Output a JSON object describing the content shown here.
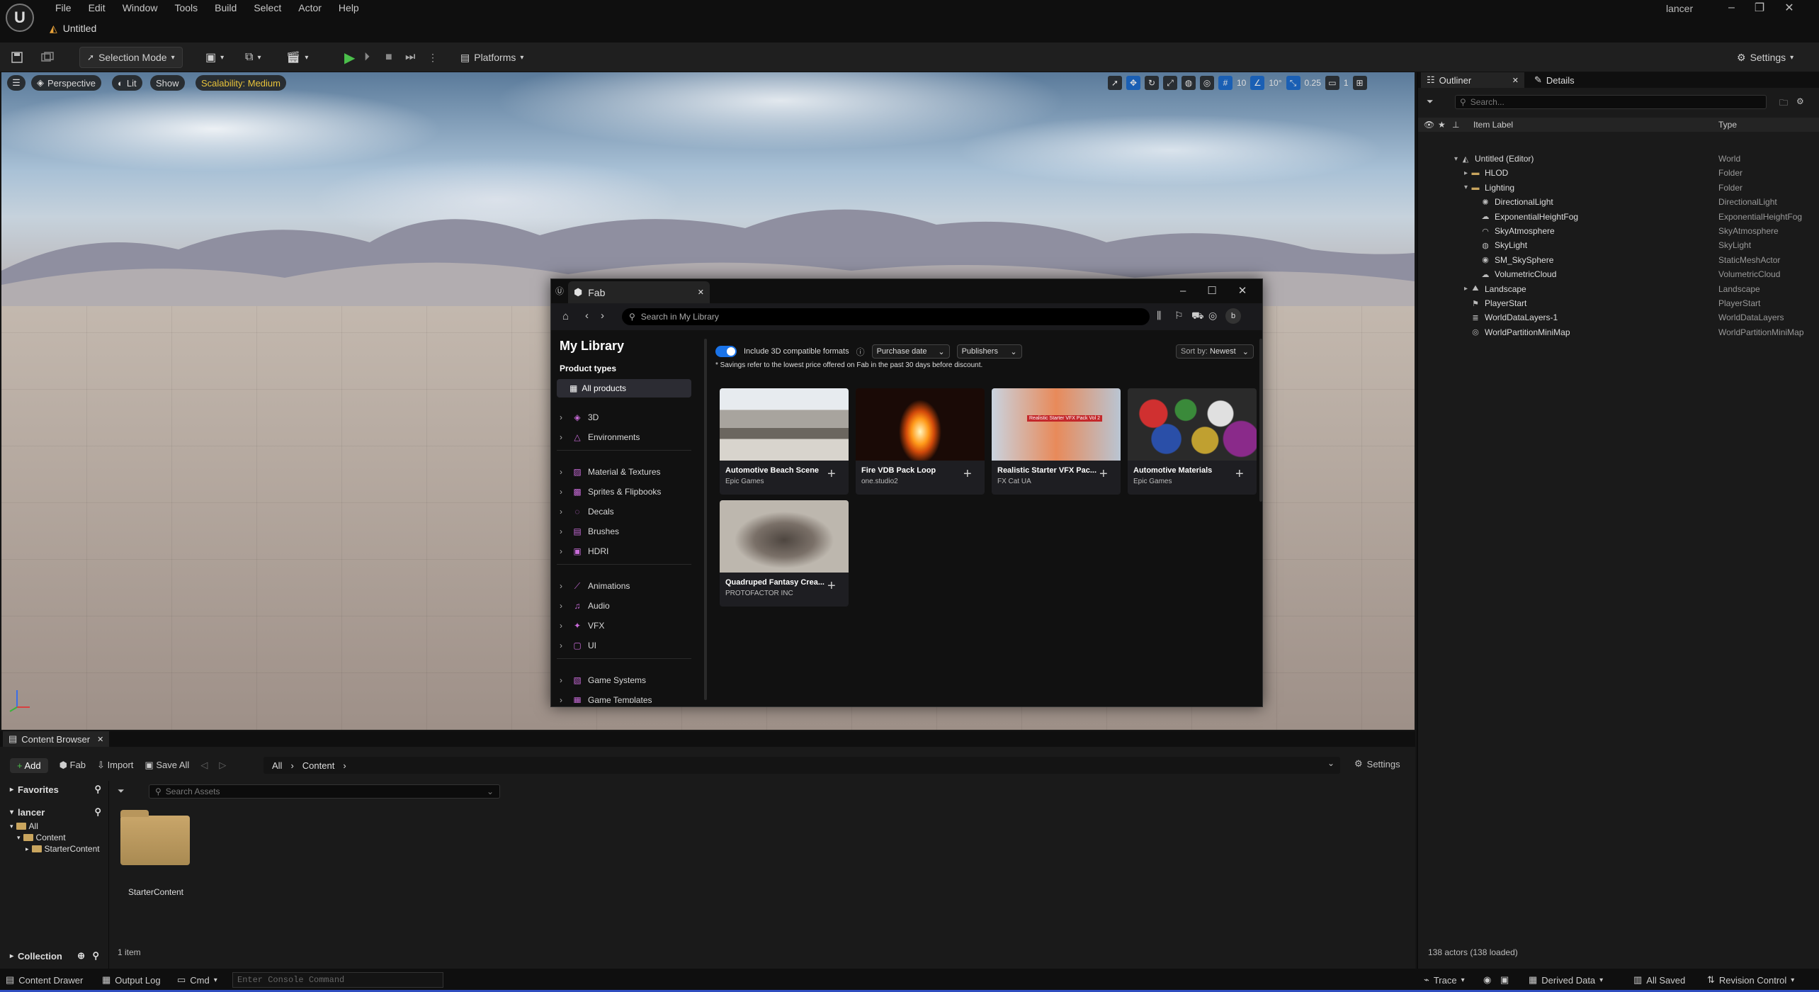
{
  "app": {
    "logo": "U",
    "menus": [
      "File",
      "Edit",
      "Window",
      "Tools",
      "Build",
      "Select",
      "Actor",
      "Help"
    ],
    "doc_tab": "Untitled",
    "user": "lancer"
  },
  "toolbar": {
    "selection_mode": "Selection Mode",
    "platforms": "Platforms",
    "settings": "Settings"
  },
  "viewport": {
    "perspective": "Perspective",
    "lit": "Lit",
    "show": "Show",
    "scalability": "Scalability: Medium",
    "grid_snap": "10",
    "rot_snap": "10°",
    "scale_snap": "0.25",
    "cam_speed": "1"
  },
  "fab": {
    "title": "Fab",
    "search_placeholder": "Search in My Library",
    "heading": "My Library",
    "product_types": "Product types",
    "all_products": "All products",
    "categories": [
      {
        "label": "3D",
        "icon": "cube-icon"
      },
      {
        "label": "Environments",
        "icon": "mountain-icon"
      },
      {
        "label": "Material & Textures",
        "icon": "material-icon"
      },
      {
        "label": "Sprites & Flipbooks",
        "icon": "sprite-icon"
      },
      {
        "label": "Decals",
        "icon": "decal-icon"
      },
      {
        "label": "Brushes",
        "icon": "brush-icon"
      },
      {
        "label": "HDRI",
        "icon": "hdri-icon"
      },
      {
        "label": "Animations",
        "icon": "animation-icon"
      },
      {
        "label": "Audio",
        "icon": "audio-icon"
      },
      {
        "label": "VFX",
        "icon": "vfx-icon"
      },
      {
        "label": "UI",
        "icon": "ui-icon"
      },
      {
        "label": "Game Systems",
        "icon": "game-systems-icon"
      },
      {
        "label": "Game Templates",
        "icon": "game-templates-icon"
      }
    ],
    "include_3d": "Include 3D compatible formats",
    "include_3d_on": true,
    "purchase_date": "Purchase date",
    "publishers": "Publishers",
    "sort_label": "Sort by:",
    "sort_value": "Newest",
    "savings_note": "* Savings refer to the lowest price offered on Fab in the past 30 days before discount.",
    "avatar": "b",
    "products": [
      {
        "name": "Automotive Beach Scene",
        "publisher": "Epic Games"
      },
      {
        "name": "Fire VDB Pack Loop",
        "publisher": "one.studio2"
      },
      {
        "name": "Realistic Starter VFX Pac...",
        "publisher": "FX Cat UA",
        "badge": "Realistic Starter VFX Pack Vol 2"
      },
      {
        "name": "Automotive Materials",
        "publisher": "Epic Games"
      },
      {
        "name": "Quadruped Fantasy Crea...",
        "publisher": "PROTOFACTOR INC"
      }
    ]
  },
  "outliner": {
    "tab_outliner": "Outliner",
    "tab_details": "Details",
    "search_placeholder": "Search...",
    "col_label": "Item Label",
    "col_type": "Type",
    "rows": [
      {
        "label": "Untitled (Editor)",
        "type": "World",
        "depth": 0,
        "expander": "▾",
        "icon": "world-icon"
      },
      {
        "label": "HLOD",
        "type": "Folder",
        "depth": 1,
        "expander": "▸",
        "icon": "folder-icon"
      },
      {
        "label": "Lighting",
        "type": "Folder",
        "depth": 1,
        "expander": "▾",
        "icon": "folder-icon"
      },
      {
        "label": "DirectionalLight",
        "type": "DirectionalLight",
        "depth": 2,
        "expander": "",
        "icon": "sun-icon"
      },
      {
        "label": "ExponentialHeightFog",
        "type": "ExponentialHeightFog",
        "depth": 2,
        "expander": "",
        "icon": "fog-icon"
      },
      {
        "label": "SkyAtmosphere",
        "type": "SkyAtmosphere",
        "depth": 2,
        "expander": "",
        "icon": "atmosphere-icon"
      },
      {
        "label": "SkyLight",
        "type": "SkyLight",
        "depth": 2,
        "expander": "",
        "icon": "skylight-icon"
      },
      {
        "label": "SM_SkySphere",
        "type": "StaticMeshActor",
        "depth": 2,
        "expander": "",
        "icon": "mesh-icon"
      },
      {
        "label": "VolumetricCloud",
        "type": "VolumetricCloud",
        "depth": 2,
        "expander": "",
        "icon": "cloud-icon"
      },
      {
        "label": "Landscape",
        "type": "Landscape",
        "depth": 1,
        "expander": "▸",
        "icon": "landscape-icon"
      },
      {
        "label": "PlayerStart",
        "type": "PlayerStart",
        "depth": 1,
        "expander": "",
        "icon": "player-icon"
      },
      {
        "label": "WorldDataLayers-1",
        "type": "WorldDataLayers",
        "depth": 1,
        "expander": "",
        "icon": "layers-icon"
      },
      {
        "label": "WorldPartitionMiniMap",
        "type": "WorldPartitionMiniMap",
        "depth": 1,
        "expander": "",
        "icon": "minimap-icon"
      }
    ],
    "footer": "138 actors (138 loaded)"
  },
  "content_browser": {
    "tab": "Content Browser",
    "add": "Add",
    "fab": "Fab",
    "import": "Import",
    "save_all": "Save All",
    "path": [
      "All",
      "Content"
    ],
    "settings": "Settings",
    "favorites": "Favorites",
    "project": "lancer",
    "tree": [
      "All",
      "Content",
      "StarterContent"
    ],
    "collection": "Collection",
    "search_placeholder": "Search Assets",
    "folder_name": "StarterContent",
    "item_count": "1 item"
  },
  "status_bar": {
    "content_drawer": "Content Drawer",
    "output_log": "Output Log",
    "cmd": "Cmd",
    "console_placeholder": "Enter Console Command",
    "trace": "Trace",
    "derived_data": "Derived Data",
    "all_saved": "All Saved",
    "revision_control": "Revision Control"
  },
  "colors": {
    "accent_blue": "#1a73e8",
    "play_green": "#4bbf4b",
    "scalability_yellow": "#e8c33a",
    "status_bar_blue": "#2f4ec0"
  }
}
